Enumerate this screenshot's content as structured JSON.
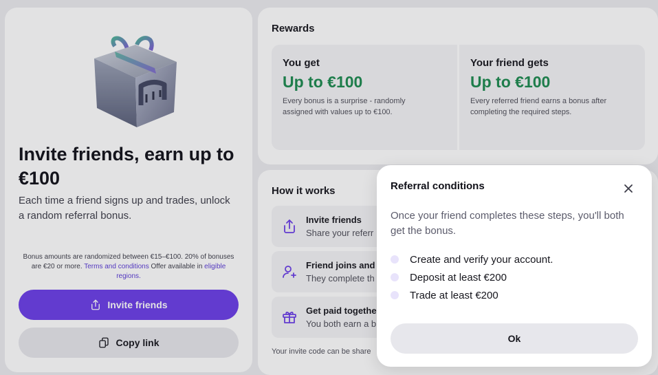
{
  "left": {
    "title": "Invite friends, earn up to €100",
    "subtitle": "Each time a friend signs up and trades, unlock a random referral bonus.",
    "disclaimer_text": "Bonus amounts are randomized between €15–€100. 20% of bonuses are €20 or more.",
    "terms_link": "Terms and conditions",
    "availability_text": "Offer available in",
    "regions_link": "eligible regions.",
    "invite_button": "Invite friends",
    "copy_button": "Copy link"
  },
  "rewards": {
    "title": "Rewards",
    "you": {
      "label": "You get",
      "amount": "Up to €100",
      "desc": "Every bonus is a surprise - randomly assigned with values up to €100."
    },
    "friend": {
      "label": "Your friend gets",
      "amount": "Up to €100",
      "desc": "Every referred friend earns a bonus after completing the required steps."
    }
  },
  "how": {
    "title": "How it works",
    "steps": [
      {
        "title": "Invite friends",
        "desc": "Share your referr",
        "icon": "share-icon"
      },
      {
        "title": "Friend joins and t",
        "desc": "They complete th",
        "icon": "user-plus-icon"
      },
      {
        "title": "Get paid togethe",
        "desc": "You both earn a b",
        "icon": "gift-icon"
      }
    ],
    "invite_code_note": "Your invite code can be share"
  },
  "modal": {
    "title": "Referral conditions",
    "intro": "Once your friend completes these steps, you'll both get the bonus.",
    "conditions": [
      "Create and verify your account.",
      "Deposit at least €200",
      "Trade at least €200"
    ],
    "ok_button": "Ok"
  },
  "colors": {
    "accent": "#6a3de8",
    "reward_green": "#1b8a4e"
  }
}
